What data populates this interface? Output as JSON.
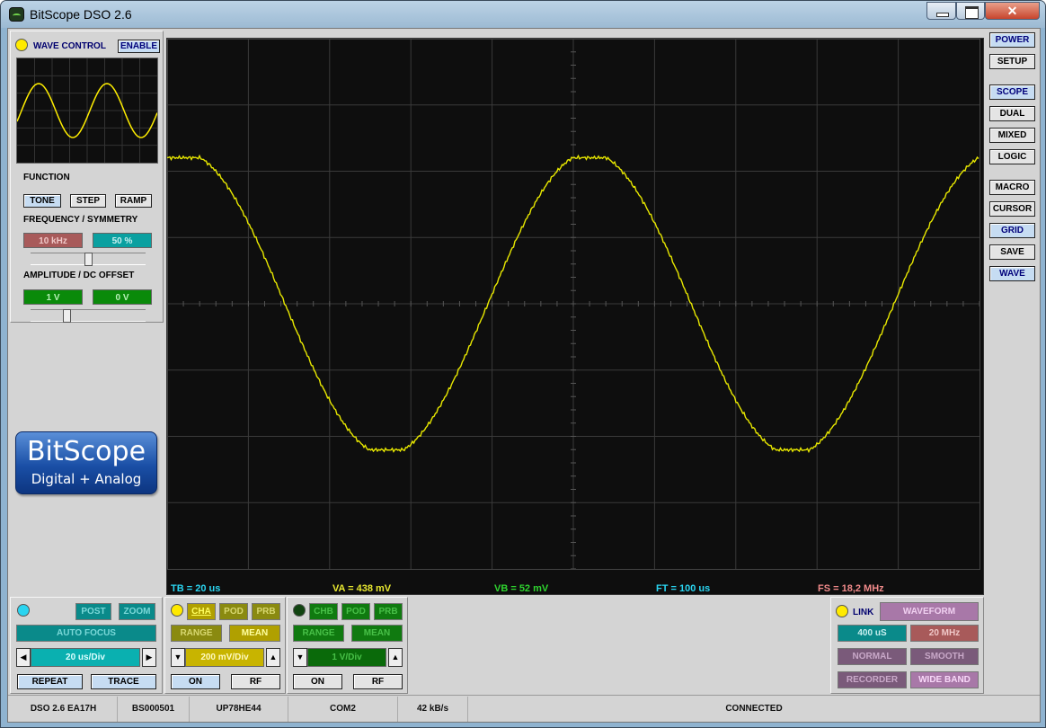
{
  "app": {
    "title": "BitScope DSO 2.6",
    "close_glyph": "✕"
  },
  "side_buttons": [
    "POWER",
    "SETUP",
    "SCOPE",
    "DUAL",
    "MIXED",
    "LOGIC",
    "MACRO",
    "CURSOR",
    "GRID",
    "SAVE",
    "WAVE"
  ],
  "wave": {
    "title": "WAVE CONTROL",
    "enable": "ENABLE",
    "function_label": "FUNCTION",
    "tone": "TONE",
    "step": "STEP",
    "ramp": "RAMP",
    "freq_label": "FREQUENCY / SYMMETRY",
    "freq": "10 kHz",
    "sym": "50 %",
    "amp_label": "AMPLITUDE / DC OFFSET",
    "amp": "1 V",
    "offset": "0 V"
  },
  "logo": {
    "line1": "BitScope",
    "line2": "Digital + Analog"
  },
  "readouts": {
    "tb": "TB = 20 us",
    "va": "VA = 438 mV",
    "vb": "VB = 52 mV",
    "ft": "FT = 100 us",
    "fs": "FS = 18,2 MHz"
  },
  "timebase": {
    "post": "POST",
    "zoom": "ZOOM",
    "autofocus": "AUTO FOCUS",
    "value": "20 us/Div",
    "repeat": "REPEAT",
    "trace": "TRACE",
    "left": "◀",
    "right": "▶"
  },
  "cha": {
    "label": "CHA",
    "pod": "POD",
    "prb": "PRB",
    "range": "RANGE",
    "mean": "MEAN",
    "value": "200 mV/Div",
    "on": "ON",
    "rf": "RF",
    "down": "▼",
    "up": "▲"
  },
  "chb": {
    "label": "CHB",
    "pod": "POD",
    "prb": "PRB",
    "range": "RANGE",
    "mean": "MEAN",
    "value": "1 V/Div",
    "on": "ON",
    "rf": "RF",
    "down": "▼",
    "up": "▲"
  },
  "link": {
    "label": "LINK",
    "waveform": "WAVEFORM",
    "rate": "400 uS",
    "bw": "20 MHz",
    "normal": "NORMAL",
    "smooth": "SMOOTH",
    "recorder": "RECORDER",
    "wideband": "WIDE BAND"
  },
  "status": [
    "DSO 2.6 EA17H",
    "BS000501",
    "UP78HE44",
    "COM2",
    "42 kB/s",
    "CONNECTED"
  ],
  "colors": {
    "trace": "#e8e800",
    "grid": "#3a3a3a",
    "cyan": "#2ad4f0",
    "yellow": "#e8e830",
    "green": "#2fd42f",
    "pink": "#f08a8a"
  }
}
